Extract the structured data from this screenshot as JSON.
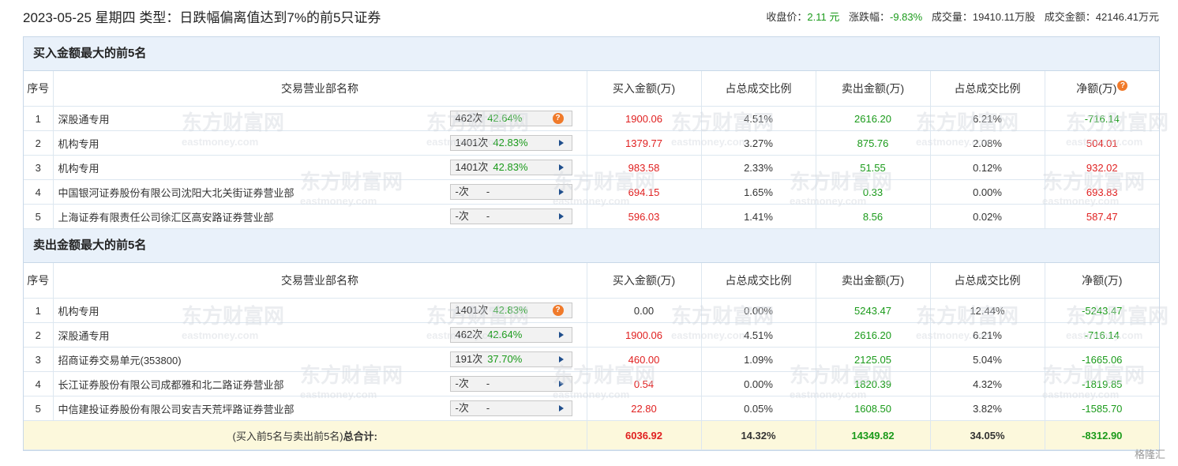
{
  "header": {
    "title": "2023-05-25 星期四 类型：日跌幅偏离值达到7%的前5只证券",
    "close_label": "收盘价：",
    "close_value": "2.11 元",
    "change_label": "涨跌幅：",
    "change_value": "-9.83%",
    "volume_label": "成交量：",
    "volume_value": "19410.11万股",
    "turnover_label": "成交金额：",
    "turnover_value": "42146.41万元"
  },
  "columns": {
    "idx": "序号",
    "name": "交易营业部名称",
    "buy": "买入金额(万)",
    "buy_ratio": "占总成交比例",
    "sell": "卖出金额(万)",
    "sell_ratio": "占总成交比例",
    "net": "净额(万)"
  },
  "buy_section": {
    "title": "买入金额最大的前5名",
    "rows": [
      {
        "idx": "1",
        "name": "深股通专用",
        "count": "462次",
        "pct": "42.64%",
        "buy": "1900.06",
        "buy_ratio": "4.51%",
        "sell": "2616.20",
        "sell_ratio": "6.21%",
        "net": "-716.14"
      },
      {
        "idx": "2",
        "name": "机构专用",
        "count": "1401次",
        "pct": "42.83%",
        "buy": "1379.77",
        "buy_ratio": "3.27%",
        "sell": "875.76",
        "sell_ratio": "2.08%",
        "net": "504.01"
      },
      {
        "idx": "3",
        "name": "机构专用",
        "count": "1401次",
        "pct": "42.83%",
        "buy": "983.58",
        "buy_ratio": "2.33%",
        "sell": "51.55",
        "sell_ratio": "0.12%",
        "net": "932.02"
      },
      {
        "idx": "4",
        "name": "中国银河证券股份有限公司沈阳大北关街证券营业部",
        "count": "-次",
        "pct": "-",
        "buy": "694.15",
        "buy_ratio": "1.65%",
        "sell": "0.33",
        "sell_ratio": "0.00%",
        "net": "693.83"
      },
      {
        "idx": "5",
        "name": "上海证券有限责任公司徐汇区高安路证券营业部",
        "count": "-次",
        "pct": "-",
        "buy": "596.03",
        "buy_ratio": "1.41%",
        "sell": "8.56",
        "sell_ratio": "0.02%",
        "net": "587.47"
      }
    ]
  },
  "sell_section": {
    "title": "卖出金额最大的前5名",
    "rows": [
      {
        "idx": "1",
        "name": "机构专用",
        "count": "1401次",
        "pct": "42.83%",
        "buy": "0.00",
        "buy_ratio": "0.00%",
        "sell": "5243.47",
        "sell_ratio": "12.44%",
        "net": "-5243.47"
      },
      {
        "idx": "2",
        "name": "深股通专用",
        "count": "462次",
        "pct": "42.64%",
        "buy": "1900.06",
        "buy_ratio": "4.51%",
        "sell": "2616.20",
        "sell_ratio": "6.21%",
        "net": "-716.14"
      },
      {
        "idx": "3",
        "name": "招商证券交易单元(353800)",
        "count": "191次",
        "pct": "37.70%",
        "buy": "460.00",
        "buy_ratio": "1.09%",
        "sell": "2125.05",
        "sell_ratio": "5.04%",
        "net": "-1665.06"
      },
      {
        "idx": "4",
        "name": "长江证券股份有限公司成都雅和北二路证券营业部",
        "count": "-次",
        "pct": "-",
        "buy": "0.54",
        "buy_ratio": "0.00%",
        "sell": "1820.39",
        "sell_ratio": "4.32%",
        "net": "-1819.85"
      },
      {
        "idx": "5",
        "name": "中信建投证券股份有限公司安吉天荒坪路证券营业部",
        "count": "-次",
        "pct": "-",
        "buy": "22.80",
        "buy_ratio": "0.05%",
        "sell": "1608.50",
        "sell_ratio": "3.82%",
        "net": "-1585.70"
      }
    ]
  },
  "total": {
    "label_prefix": "(买入前5名与卖出前5名)",
    "label_bold": "总合计:",
    "buy": "6036.92",
    "buy_ratio": "14.32%",
    "sell": "14349.82",
    "sell_ratio": "34.05%",
    "net": "-8312.90"
  },
  "watermark": {
    "text": "东方财富网",
    "subtext": "eastmoney.com"
  },
  "brand": "格隆汇",
  "colors": {
    "up": "#e02020",
    "down": "#1a9a1a",
    "section_bg": "#e9f1fa",
    "total_bg": "#fcf8dc",
    "badge": "#f07a2a"
  }
}
